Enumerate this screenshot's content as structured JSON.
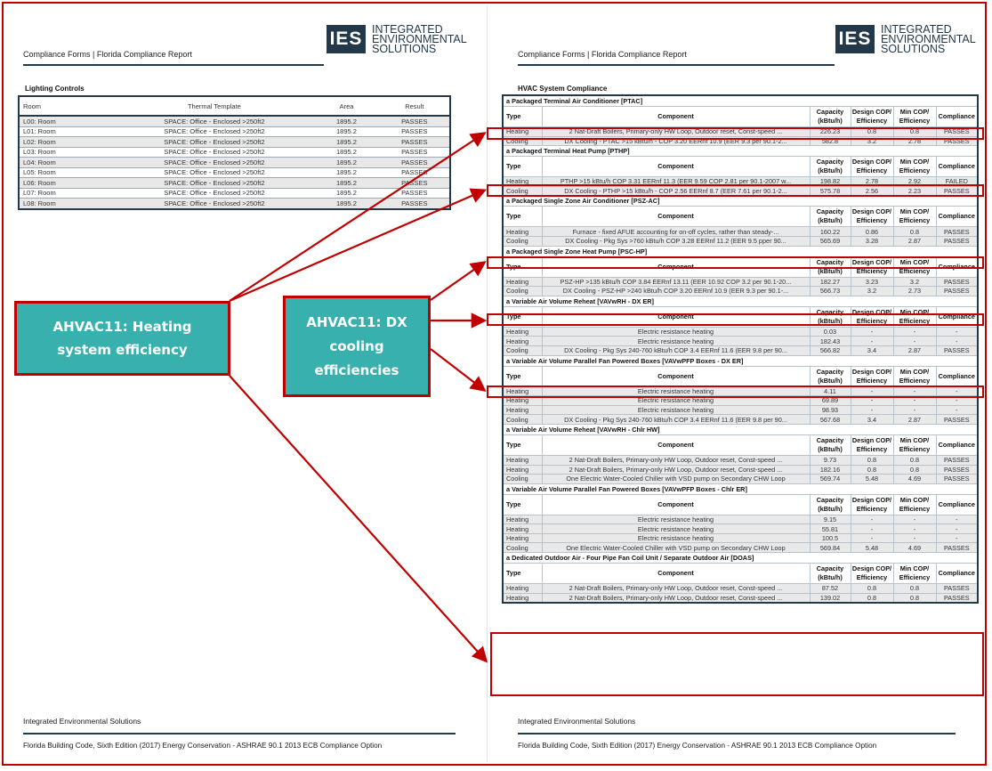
{
  "header": {
    "title": "Compliance Forms  | Florida Compliance Report",
    "logo_box": "IES",
    "logo_line1": "INTEGRATED",
    "logo_line2": "ENVIRONMENTAL",
    "logo_line3": "SOLUTIONS"
  },
  "lighting": {
    "title": "Lighting Controls",
    "columns": [
      "Room",
      "Thermal Template",
      "Area",
      "Result"
    ],
    "rows": [
      [
        "L00: Room",
        "SPACE: Office - Enclosed >250ft2",
        "1895.2",
        "PASSES"
      ],
      [
        "L01: Room",
        "SPACE: Office - Enclosed >250ft2",
        "1895.2",
        "PASSES"
      ],
      [
        "L02: Room",
        "SPACE: Office - Enclosed >250ft2",
        "1895.2",
        "PASSES"
      ],
      [
        "L03: Room",
        "SPACE: Office - Enclosed >250ft2",
        "1895.2",
        "PASSES"
      ],
      [
        "L04: Room",
        "SPACE: Office - Enclosed >250ft2",
        "1895.2",
        "PASSES"
      ],
      [
        "L05: Room",
        "SPACE: Office - Enclosed >250ft2",
        "1895.2",
        "PASSES"
      ],
      [
        "L06: Room",
        "SPACE: Office - Enclosed >250ft2",
        "1895.2",
        "PASSES"
      ],
      [
        "L07: Room",
        "SPACE: Office - Enclosed >250ft2",
        "1895.2",
        "PASSES"
      ],
      [
        "L08: Room",
        "SPACE: Office - Enclosed >250ft2",
        "1895.2",
        "PASSES"
      ]
    ]
  },
  "hvac": {
    "title": "HVAC System Compliance",
    "columns": [
      "Type",
      "Component",
      "Capacity (kBtu/h)",
      "Design COP/ Efficiency",
      "Min COP/ Efficiency",
      "Compliance"
    ],
    "systems": [
      {
        "name": "a Packaged Terminal Air Conditioner [PTAC]",
        "rows": [
          [
            "Heating",
            "2 Nat-Draft Boilers, Primary-only HW Loop, Outdoor reset, Const-speed ...",
            "226.23",
            "0.8",
            "0.8",
            "PASSES"
          ],
          [
            "Cooling",
            "DX Cooling - PTAC >15 kBtu/h - COP 3.20 EERnf 10.9 (EER 9.3 per 90.1-2...",
            "582.8",
            "3.2",
            "2.78",
            "PASSES"
          ]
        ]
      },
      {
        "name": "a Packaged Terminal Heat Pump [PTHP]",
        "rows": [
          [
            "Heating",
            "PTHP >15 kBtu/h COP 3.31 EERnf 11.3 (EER 9.59 COP 2.81 per 90.1-2007 w...",
            "198.82",
            "2.78",
            "2.92",
            "FAILED"
          ],
          [
            "Cooling",
            "DX Cooling - PTHP >15 kBtu/h - COP 2.56 EERnf 8.7 (EER 7.61 per 90.1-2...",
            "575.78",
            "2.56",
            "2.23",
            "PASSES"
          ]
        ]
      },
      {
        "name": "a Packaged Single Zone Air Conditioner [PSZ-AC]",
        "rows": [
          [
            "Heating",
            "Furnace - fixed AFUE accounting for on-off cycles, rather than steady-...",
            "160.22",
            "0.86",
            "0.8",
            "PASSES"
          ],
          [
            "Cooling",
            "DX Cooling - Pkg Sys >760 kBtu/h COP 3.28 EERnf 11.2 (EER 9.5 pper 90...",
            "565.69",
            "3.28",
            "2.87",
            "PASSES"
          ]
        ]
      },
      {
        "name": "a Packaged Single Zone Heat Pump [PSC-HP]",
        "rows": [
          [
            "Heating",
            "PSZ-HP >135 kBtu/h COP 3.84 EERnf 13.11 (EER 10.92 COP 3.2 per 90.1-20...",
            "182.27",
            "3.23",
            "3.2",
            "PASSES"
          ],
          [
            "Cooling",
            "DX Cooling - PSZ-HP >240 kBtu/h COP 3.20 EERnf 10.9 (EER 9.3 per 90.1-...",
            "566.73",
            "3.2",
            "2.73",
            "PASSES"
          ]
        ]
      },
      {
        "name": "a Variable Air Volume Reheat [VAVwRH - DX ER]",
        "rows": [
          [
            "Heating",
            "Electric resistance heating",
            "0.03",
            "-",
            "-",
            "-"
          ],
          [
            "Heating",
            "Electric resistance heating",
            "182.43",
            "-",
            "-",
            "-"
          ],
          [
            "Cooling",
            "DX Cooling - Pkg Sys 240-760 kBtu/h COP 3.4 EERnf 11.6 (EER 9.8 per 90...",
            "566.82",
            "3.4",
            "2.87",
            "PASSES"
          ]
        ]
      },
      {
        "name": "a Variable Air Volume Parallel Fan Powered Boxes [VAVwPFP Boxes - DX ER]",
        "rows": [
          [
            "Heating",
            "Electric resistance heating",
            "4.11",
            "-",
            "-",
            "-"
          ],
          [
            "Heating",
            "Electric resistance heating",
            "69.89",
            "-",
            "-",
            "-"
          ],
          [
            "Heating",
            "Electric resistance heating",
            "98.93",
            "-",
            "-",
            "-"
          ],
          [
            "Cooling",
            "DX Cooling - Pkg Sys 240-760 kBtu/h COP 3.4 EERnf 11.6 (EER 9.8 per 90...",
            "567.68",
            "3.4",
            "2.87",
            "PASSES"
          ]
        ]
      },
      {
        "name": "a Variable Air Volume Reheat [VAVwRH - Chlr HW]",
        "rows": [
          [
            "Heating",
            "2 Nat-Draft Boilers, Primary-only HW Loop, Outdoor reset, Const-speed ...",
            "9.73",
            "0.8",
            "0.8",
            "PASSES"
          ],
          [
            "Heating",
            "2 Nat-Draft Boilers, Primary-only HW Loop, Outdoor reset, Const-speed ...",
            "182.16",
            "0.8",
            "0.8",
            "PASSES"
          ],
          [
            "Cooling",
            "One Electric Water-Cooled Chiller with VSD pump on Secondary CHW Loop",
            "569.74",
            "5.48",
            "4.69",
            "PASSES"
          ]
        ]
      },
      {
        "name": "a Variable Air Volume Parallel Fan Powered Boxes [VAVwPFP Boxes - Chlr ER]",
        "rows": [
          [
            "Heating",
            "Electric resistance heating",
            "9.15",
            "-",
            "-",
            "-"
          ],
          [
            "Heating",
            "Electric resistance heating",
            "55.81",
            "-",
            "-",
            "-"
          ],
          [
            "Heating",
            "Electric resistance heating",
            "100.5",
            "-",
            "-",
            "-"
          ],
          [
            "Cooling",
            "One Electric Water-Cooled Chiller with VSD pump on Secondary CHW Loop",
            "569.84",
            "5.48",
            "4.69",
            "PASSES"
          ]
        ]
      },
      {
        "name": "a Dedicated Outdoor Air - Four Pipe Fan Coil Unit / Separate Outdoor Air [DOAS]",
        "rows": [
          [
            "Heating",
            "2 Nat-Draft Boilers, Primary-only HW Loop, Outdoor reset, Const-speed ...",
            "87.52",
            "0.8",
            "0.8",
            "PASSES"
          ],
          [
            "Heating",
            "2 Nat-Draft Boilers, Primary-only HW Loop, Outdoor reset, Const-speed ...",
            "139.02",
            "0.8",
            "0.8",
            "PASSES"
          ]
        ]
      }
    ]
  },
  "callouts": {
    "heating_line1": "AHVAC11: Heating",
    "heating_line2": "system efficiency",
    "dx_line1": "AHVAC11: DX",
    "dx_line2": "cooling",
    "dx_line3": "efficiencies"
  },
  "footer": {
    "org": "Integrated Environmental Solutions",
    "code": "Florida Building Code, Sixth Edition (2017) Energy Conservation - ASHRAE 90.1 2013 ECB Compliance Option"
  },
  "colors": {
    "navy": "#23394a",
    "callout_teal": "#37b0ae",
    "annotation_red": "#c00000"
  }
}
